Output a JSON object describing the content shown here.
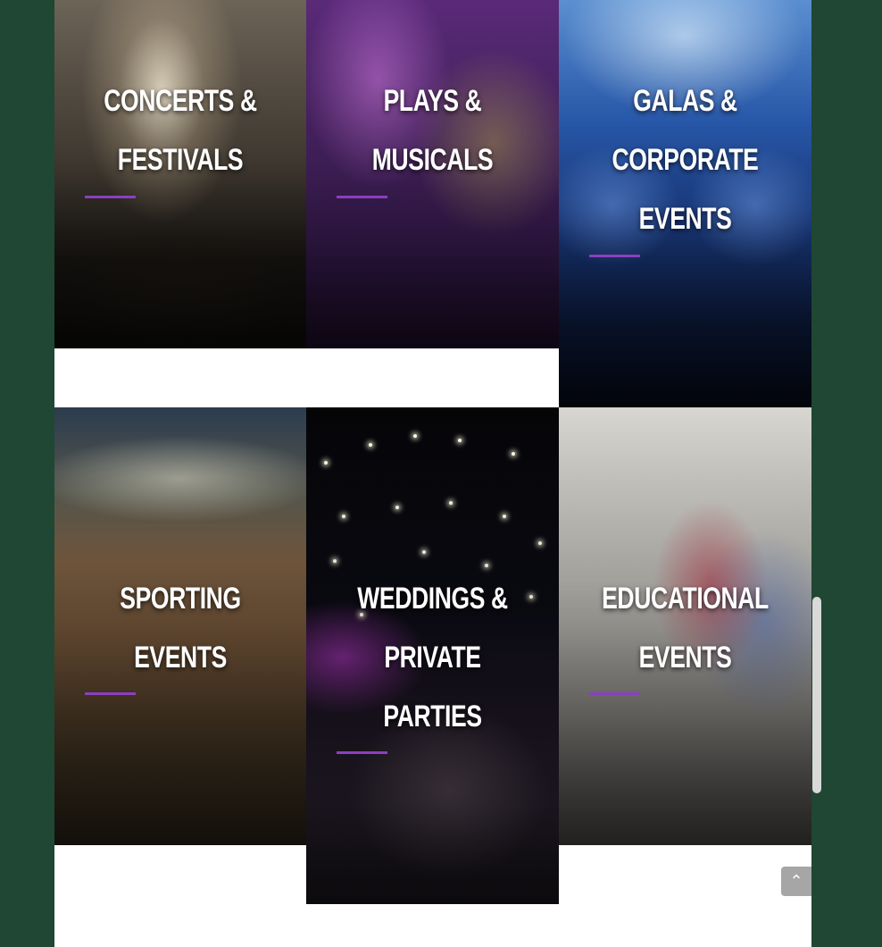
{
  "tiles": [
    {
      "lines": [
        "CONCERTS &",
        "FESTIVALS"
      ]
    },
    {
      "lines": [
        "PLAYS &",
        "MUSICALS"
      ]
    },
    {
      "lines": [
        "GALAS &",
        "CORPORATE",
        "EVENTS"
      ]
    },
    {
      "lines": [
        "SPORTING",
        "EVENTS"
      ]
    },
    {
      "lines": [
        "WEDDINGS &",
        "PRIVATE",
        "PARTIES"
      ]
    },
    {
      "lines": [
        "EDUCATIONAL",
        "EVENTS"
      ]
    }
  ],
  "colors": {
    "accent": "#8b3fbf",
    "outer_background": "#1f4733",
    "page_background": "#ffffff"
  },
  "back_to_top_icon": "chevron-up-icon"
}
